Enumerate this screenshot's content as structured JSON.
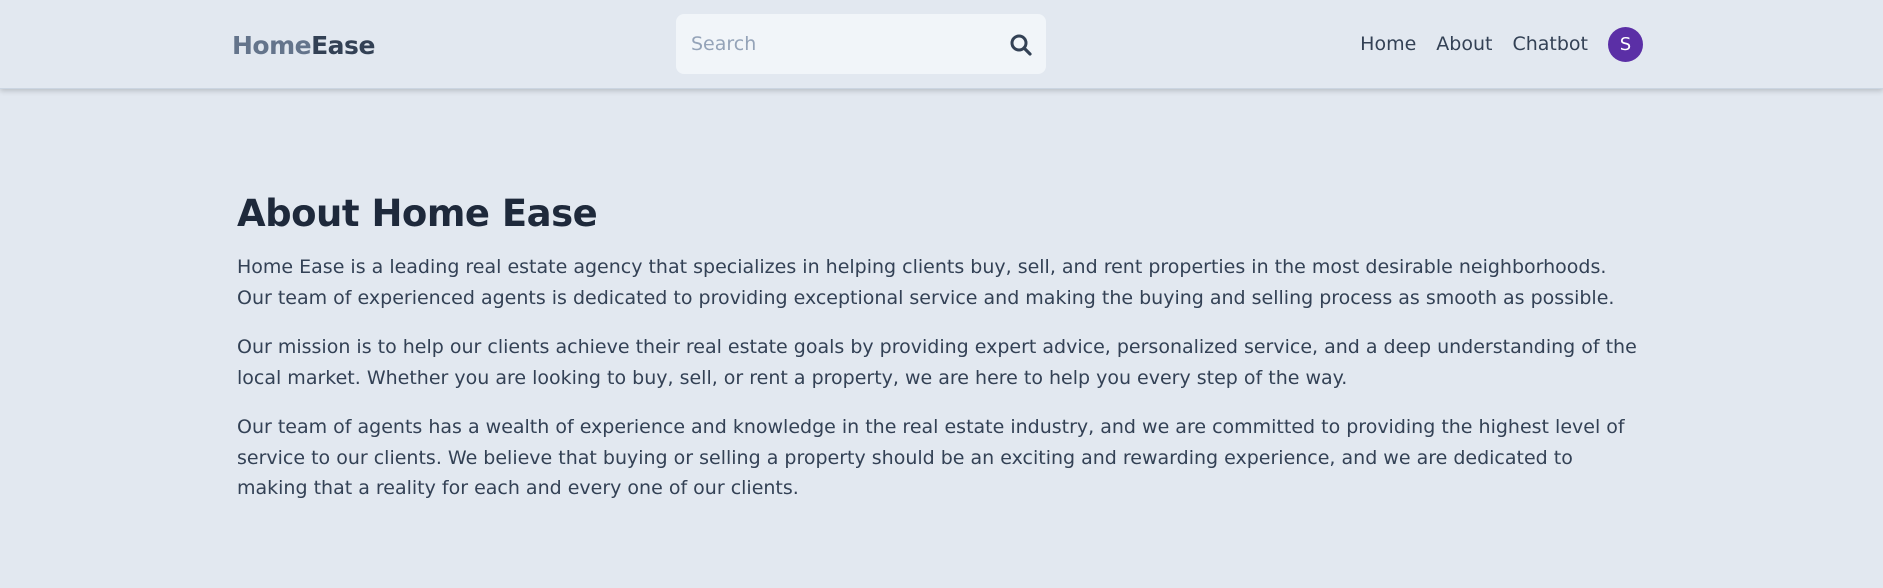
{
  "header": {
    "logo_part1": "Home",
    "logo_part2": "Ease",
    "search": {
      "placeholder": "Search",
      "value": "",
      "icon": "search-icon"
    },
    "nav": [
      {
        "label": "Home"
      },
      {
        "label": "About"
      },
      {
        "label": "Chatbot"
      }
    ],
    "avatar": {
      "initial": "S",
      "color": "#5b2fa6"
    }
  },
  "main": {
    "title": "About Home Ease",
    "paragraphs": [
      "Home Ease is a leading real estate agency that specializes in helping clients buy, sell, and rent properties in the most desirable neighborhoods. Our team of experienced agents is dedicated to providing exceptional service and making the buying and selling process as smooth as possible.",
      "Our mission is to help our clients achieve their real estate goals by providing expert advice, personalized service, and a deep understanding of the local market. Whether you are looking to buy, sell, or rent a property, we are here to help you every step of the way.",
      "Our team of agents has a wealth of experience and knowledge in the real estate industry, and we are committed to providing the highest level of service to our clients. We believe that buying or selling a property should be an exciting and rewarding experience, and we are dedicated to making that a reality for each and every one of our clients."
    ]
  },
  "colors": {
    "background": "#e2e8f0",
    "search_bg": "#f1f5f9",
    "text_dark": "#1e293b",
    "text_body": "#334155",
    "logo_light": "#64748b",
    "avatar": "#5b2fa6"
  }
}
